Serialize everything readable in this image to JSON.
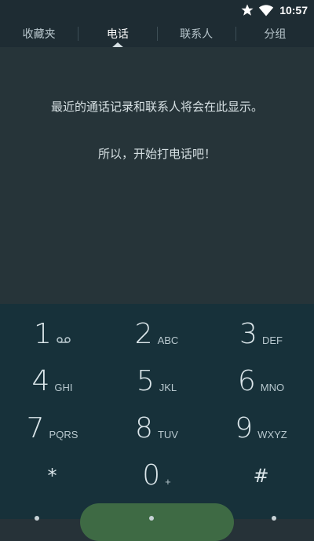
{
  "status_bar": {
    "time": "10:57",
    "icons": [
      "star-icon",
      "wifi-icon"
    ]
  },
  "tabs": [
    {
      "label": "收藏夹",
      "active": false
    },
    {
      "label": "电话",
      "active": true
    },
    {
      "label": "联系人",
      "active": false
    },
    {
      "label": "分组",
      "active": false
    }
  ],
  "empty_state": {
    "line1": "最近的通话记录和联系人将会在此显示。",
    "line2": "所以，开始打电话吧！"
  },
  "dialpad": {
    "keys": [
      {
        "digit": "1",
        "letters": "ₒₒ"
      },
      {
        "digit": "2",
        "letters": "ABC"
      },
      {
        "digit": "3",
        "letters": "DEF"
      },
      {
        "digit": "4",
        "letters": "GHI"
      },
      {
        "digit": "5",
        "letters": "JKL"
      },
      {
        "digit": "6",
        "letters": "MNO"
      },
      {
        "digit": "7",
        "letters": "PQRS"
      },
      {
        "digit": "8",
        "letters": "TUV"
      },
      {
        "digit": "9",
        "letters": "WXYZ"
      },
      {
        "digit": "*",
        "letters": ""
      },
      {
        "digit": "0",
        "letters": "+"
      },
      {
        "digit": "#",
        "letters": ""
      }
    ]
  },
  "colors": {
    "background": "#263238",
    "dialpad": "#17313a",
    "call_button": "#3e6a44"
  }
}
